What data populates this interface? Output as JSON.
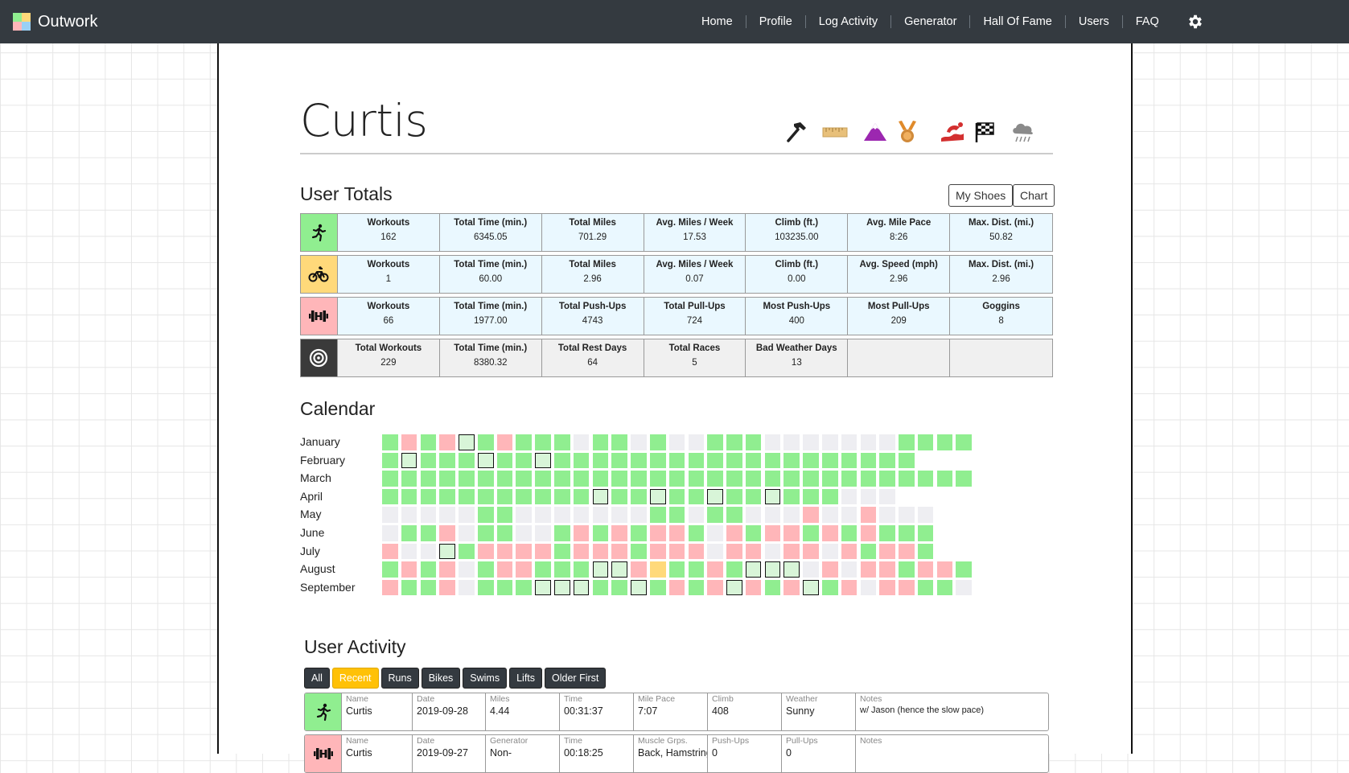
{
  "nav": {
    "brand": "Outwork",
    "links": [
      "Home",
      "Profile",
      "Log Activity",
      "Generator",
      "Hall Of Fame",
      "Users",
      "FAQ"
    ]
  },
  "colors": {
    "nav_bg": "#343a40",
    "run": "#90ee90",
    "bike": "#ffd97a",
    "lift": "#ffb6b9",
    "total": "#3a3a3a",
    "rest": "#eeeef2",
    "race_fill": "#d8f5d8",
    "accent": "#ffc107"
  },
  "profile": {
    "name": "Curtis",
    "achievements": [
      "hammer-icon",
      "ruler-icon",
      "mountain-icon",
      "medal-icon",
      "swim-icon",
      "checkered-flag-icon",
      "rain-cloud-icon"
    ]
  },
  "totals": {
    "title": "User Totals",
    "buttons": [
      "My Shoes",
      "Chart"
    ],
    "rows": [
      {
        "type": "run",
        "icon": "run-icon",
        "cells": [
          [
            "Workouts",
            "162"
          ],
          [
            "Total Time (min.)",
            "6345.05"
          ],
          [
            "Total Miles",
            "701.29"
          ],
          [
            "Avg. Miles / Week",
            "17.53"
          ],
          [
            "Climb (ft.)",
            "103235.00"
          ],
          [
            "Avg. Mile Pace",
            "8:26"
          ],
          [
            "Max. Dist. (mi.)",
            "50.82"
          ]
        ]
      },
      {
        "type": "bike",
        "icon": "bike-icon",
        "cells": [
          [
            "Workouts",
            "1"
          ],
          [
            "Total Time (min.)",
            "60.00"
          ],
          [
            "Total Miles",
            "2.96"
          ],
          [
            "Avg. Miles / Week",
            "0.07"
          ],
          [
            "Climb (ft.)",
            "0.00"
          ],
          [
            "Avg. Speed (mph)",
            "2.96"
          ],
          [
            "Max. Dist. (mi.)",
            "2.96"
          ]
        ]
      },
      {
        "type": "lift",
        "icon": "dumbbell-icon",
        "cells": [
          [
            "Workouts",
            "66"
          ],
          [
            "Total Time (min.)",
            "1977.00"
          ],
          [
            "Total Push-Ups",
            "4743"
          ],
          [
            "Total Pull-Ups",
            "724"
          ],
          [
            "Most Push-Ups",
            "400"
          ],
          [
            "Most Pull-Ups",
            "209"
          ],
          [
            "Goggins",
            "8"
          ]
        ]
      },
      {
        "type": "total",
        "icon": "target-icon",
        "cells": [
          [
            "Total Workouts",
            "229"
          ],
          [
            "Total Time (min.)",
            "8380.32"
          ],
          [
            "Total Rest Days",
            "64"
          ],
          [
            "Total Races",
            "5"
          ],
          [
            "Bad Weather Days",
            "13"
          ],
          [
            "",
            ""
          ],
          [
            "",
            ""
          ]
        ]
      }
    ]
  },
  "calendar": {
    "title": "Calendar",
    "months": [
      {
        "name": "January",
        "days": "RLRLXRLRRRERREREERRREEEEEEERRRR"
      },
      {
        "name": "February",
        "days": "RXRRRXRRXRRRRRRRRRRRRRRRRRRR"
      },
      {
        "name": "March",
        "days": "RRRRRRRRRRRRRRRRRRRRRRRRRRRRRRR"
      },
      {
        "name": "April",
        "days": "RRRRRRRRRRRXRRXRRXRRXRRREEE"
      },
      {
        "name": "May",
        "days": "EEEEERREEEEEEERRERREEELEELEEE"
      },
      {
        "name": "June",
        "days": "ERRLERREERLRLRLLRELRLLRLRLRRR"
      },
      {
        "name": "July",
        "days": "LEEXRLLLLRLLLRLLLELLELLELRLLR"
      },
      {
        "name": "August",
        "days": "RLRLERLLRRRXXLBRRLRXXXELELLRLLR"
      },
      {
        "name": "September",
        "days": "LRRLERRRXXXRRXRLRLXLRLXRLELLRRE"
      }
    ]
  },
  "activity": {
    "title": "User Activity",
    "filters": [
      "All",
      "Recent",
      "Runs",
      "Bikes",
      "Swims",
      "Lifts",
      "Older First"
    ],
    "active_filter": "Recent",
    "rows": [
      {
        "type": "run",
        "icon": "run-icon",
        "cells": [
          [
            "Name",
            "Curtis"
          ],
          [
            "Date",
            "2019-09-28"
          ],
          [
            "Miles",
            "4.44"
          ],
          [
            "Time",
            "00:31:37"
          ],
          [
            "Mile Pace",
            "7:07"
          ],
          [
            "Climb",
            "408"
          ],
          [
            "Weather",
            "Sunny"
          ],
          [
            "Notes",
            "w/ Jason (hence the slow pace)"
          ]
        ]
      },
      {
        "type": "lift",
        "icon": "dumbbell-icon",
        "cells": [
          [
            "Name",
            "Curtis"
          ],
          [
            "Date",
            "2019-09-27"
          ],
          [
            "Generator",
            "Non-"
          ],
          [
            "Time",
            "00:18:25"
          ],
          [
            "Muscle Grps.",
            "Back, Hamstrings"
          ],
          [
            "Push-Ups",
            "0"
          ],
          [
            "Pull-Ups",
            "0"
          ],
          [
            "Notes",
            ""
          ]
        ]
      }
    ]
  }
}
